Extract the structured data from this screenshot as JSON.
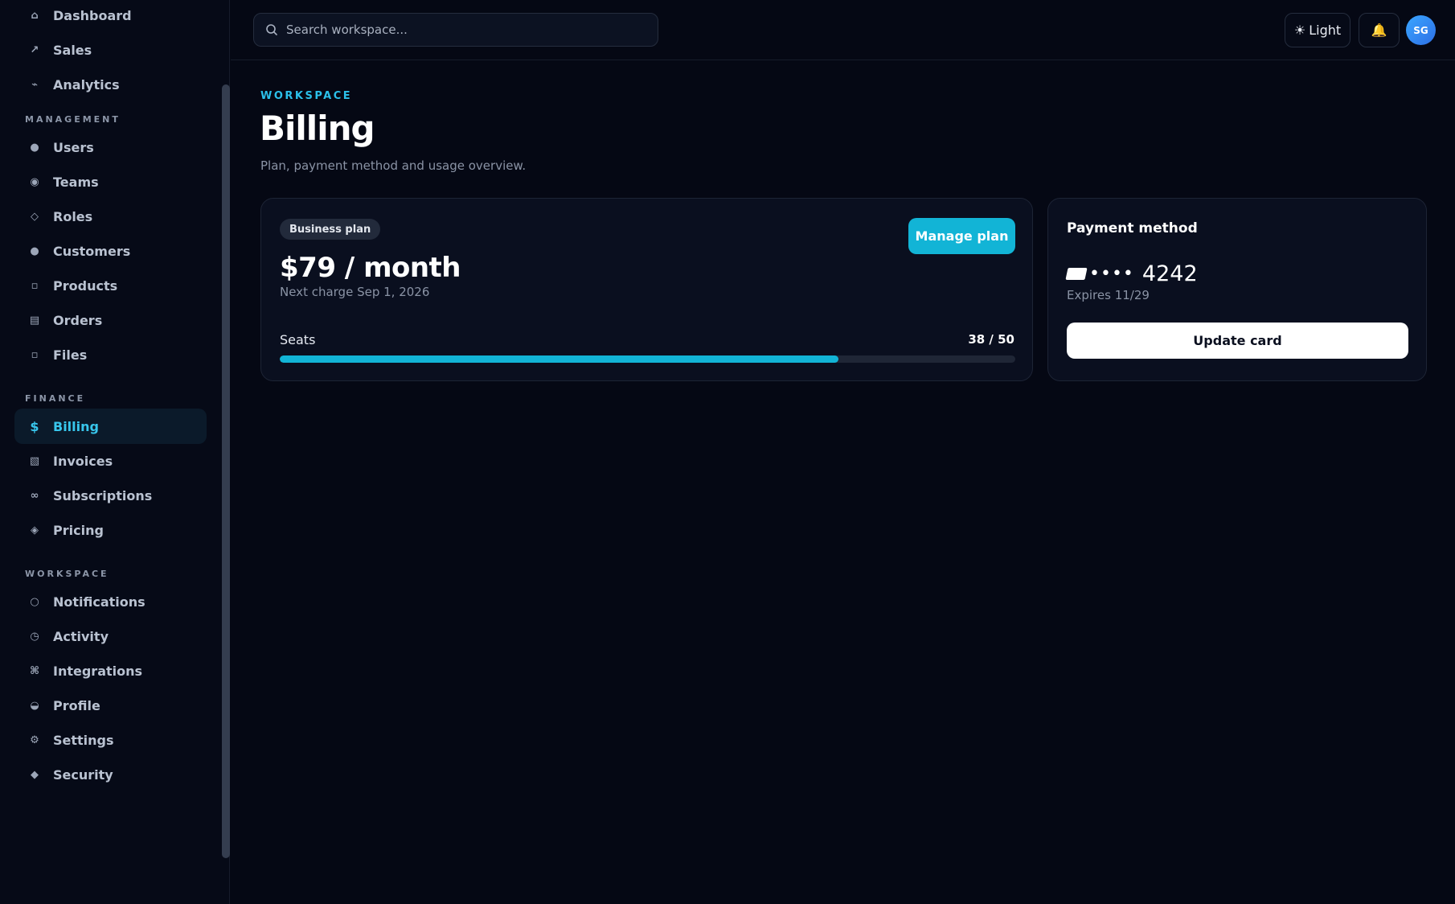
{
  "sidebar": {
    "items_top": [
      {
        "icon": "⌂",
        "icon_name": "home-icon",
        "label": "Dashboard"
      },
      {
        "icon": "↗",
        "icon_name": "trend-up-icon",
        "label": "Sales"
      },
      {
        "icon": "⌁",
        "icon_name": "analytics-icon",
        "label": "Analytics"
      }
    ],
    "sections": [
      {
        "title": "MANAGEMENT",
        "items": [
          {
            "icon": "●",
            "icon_name": "users-icon",
            "label": "Users"
          },
          {
            "icon": "◉",
            "icon_name": "teams-icon",
            "label": "Teams"
          },
          {
            "icon": "◇",
            "icon_name": "roles-icon",
            "label": "Roles"
          },
          {
            "icon": "●",
            "icon_name": "customers-icon",
            "label": "Customers"
          },
          {
            "icon": "▫",
            "icon_name": "products-icon",
            "label": "Products"
          },
          {
            "icon": "▤",
            "icon_name": "orders-icon",
            "label": "Orders"
          },
          {
            "icon": "▫",
            "icon_name": "files-icon",
            "label": "Files"
          }
        ]
      },
      {
        "title": "FINANCE",
        "items": [
          {
            "icon": "$",
            "icon_name": "dollar-icon",
            "label": "Billing",
            "active": true
          },
          {
            "icon": "▧",
            "icon_name": "invoices-icon",
            "label": "Invoices"
          },
          {
            "icon": "∞",
            "icon_name": "subscriptions-icon",
            "label": "Subscriptions"
          },
          {
            "icon": "◈",
            "icon_name": "pricing-icon",
            "label": "Pricing"
          }
        ]
      },
      {
        "title": "WORKSPACE",
        "items": [
          {
            "icon": "○",
            "icon_name": "notifications-icon",
            "label": "Notifications"
          },
          {
            "icon": "◷",
            "icon_name": "activity-icon",
            "label": "Activity"
          },
          {
            "icon": "⌘",
            "icon_name": "integrations-icon",
            "label": "Integrations"
          },
          {
            "icon": "◒",
            "icon_name": "profile-icon",
            "label": "Profile"
          },
          {
            "icon": "⚙",
            "icon_name": "settings-icon",
            "label": "Settings"
          },
          {
            "icon": "◆",
            "icon_name": "security-icon",
            "label": "Security"
          }
        ]
      }
    ]
  },
  "topbar": {
    "search_placeholder": "Search workspace...",
    "theme_icon": "☀",
    "theme_label": "Light",
    "bell_icon": "🔔",
    "avatar_initials": "SG"
  },
  "page": {
    "eyebrow": "WORKSPACE",
    "title": "Billing",
    "subtitle": "Plan, payment method and usage overview."
  },
  "plan": {
    "badge": "Business plan",
    "price": "$79 / month",
    "next_charge": "Next charge Sep 1, 2026",
    "manage_label": "Manage plan",
    "seats_label": "Seats",
    "seats_count": "38 / 50",
    "seats_used": 38,
    "seats_total": 50
  },
  "payment": {
    "title": "Payment method",
    "card_dots": "••••",
    "card_last4": "4242",
    "expires": "Expires 11/29",
    "update_label": "Update card"
  },
  "colors": {
    "accent": "#12b4d6",
    "background": "#050814",
    "card": "#0a0f1f"
  }
}
